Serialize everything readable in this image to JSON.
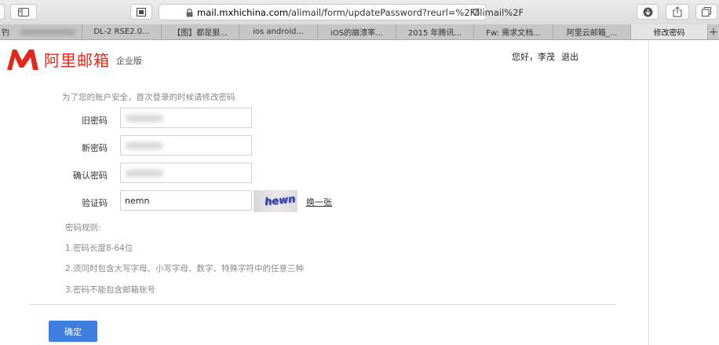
{
  "browser": {
    "url_domain": "mail.mxhichina.com",
    "url_path": "/alimail/form/updatePassword?reurl=%2Falimail%2F",
    "tabs": [
      {
        "label": "",
        "blurred": true,
        "active": false
      },
      {
        "label": "DL-2 RSE2.0...",
        "active": false
      },
      {
        "label": "【图】都是狠...",
        "active": false
      },
      {
        "label": "ios android...",
        "active": false
      },
      {
        "label": "iOS的崩溃率...",
        "active": false
      },
      {
        "label": "2015 年腾讯...",
        "active": false
      },
      {
        "label": "Fw: 需求文档...",
        "active": false
      },
      {
        "label": "阿里云邮箱_...",
        "active": false
      },
      {
        "label": "修改密码",
        "active": true
      }
    ],
    "first_tab_prefix": "钓"
  },
  "header": {
    "logo_text": "阿里邮箱",
    "edition": "企业版",
    "greeting": "您好，李茂",
    "logout": "退出",
    "brand_color": "#e2281b"
  },
  "form": {
    "notice": "为了您的账户安全，首次登录的时候请修改密码",
    "old_password_label": "旧密码",
    "new_password_label": "新密码",
    "confirm_password_label": "确认密码",
    "captcha_label": "验证码",
    "captcha_value": "nemn",
    "captcha_image_text": "hewn",
    "refresh_label": "换一张",
    "rules_title": "密码规则:",
    "rule_1": "1.密码长度8-64位",
    "rule_2": "2.须同时包含大写字母、小写字母、数字、特殊字符中的任意三种",
    "rule_3": "3.密码不能包含邮箱账号",
    "submit_label": "确定",
    "submit_color": "#3d7fe0"
  }
}
